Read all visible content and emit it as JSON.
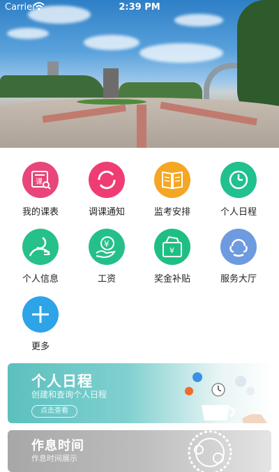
{
  "status_bar": {
    "carrier": "Carrier",
    "time": "2:39 PM"
  },
  "menu": [
    {
      "label": "我的课表",
      "icon": "timetable-icon",
      "color": "#e8467a"
    },
    {
      "label": "调课通知",
      "icon": "refresh-icon",
      "color": "#ef3d73"
    },
    {
      "label": "监考安排",
      "icon": "book-icon",
      "color": "#f5a623"
    },
    {
      "label": "个人日程",
      "icon": "clock-icon",
      "color": "#20c08f"
    },
    {
      "label": "个人信息",
      "icon": "profile-icon",
      "color": "#26c08a"
    },
    {
      "label": "工资",
      "icon": "salary-icon",
      "color": "#25c08a"
    },
    {
      "label": "奖金补贴",
      "icon": "bonus-icon",
      "color": "#1fbf83"
    },
    {
      "label": "服务大厅",
      "icon": "service-icon",
      "color": "#6e9be0"
    },
    {
      "label": "更多",
      "icon": "plus-icon",
      "color": "#2da3e8"
    }
  ],
  "banners": {
    "schedule": {
      "title": "个人日程",
      "subtitle": "创建和查询个人日程",
      "button": "点击查看"
    },
    "rest": {
      "title": "作息时间",
      "subtitle": "作息时间展示"
    }
  }
}
